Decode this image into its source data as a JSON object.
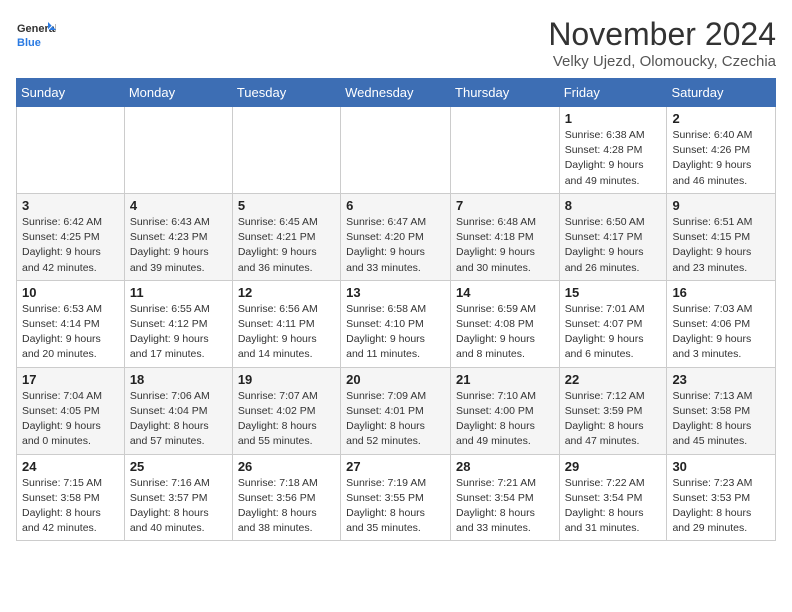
{
  "logo": {
    "line1": "General",
    "line2": "Blue"
  },
  "header": {
    "month": "November 2024",
    "location": "Velky Ujezd, Olomoucky, Czechia"
  },
  "weekdays": [
    "Sunday",
    "Monday",
    "Tuesday",
    "Wednesday",
    "Thursday",
    "Friday",
    "Saturday"
  ],
  "weeks": [
    [
      {
        "day": "",
        "info": ""
      },
      {
        "day": "",
        "info": ""
      },
      {
        "day": "",
        "info": ""
      },
      {
        "day": "",
        "info": ""
      },
      {
        "day": "",
        "info": ""
      },
      {
        "day": "1",
        "info": "Sunrise: 6:38 AM\nSunset: 4:28 PM\nDaylight: 9 hours and 49 minutes."
      },
      {
        "day": "2",
        "info": "Sunrise: 6:40 AM\nSunset: 4:26 PM\nDaylight: 9 hours and 46 minutes."
      }
    ],
    [
      {
        "day": "3",
        "info": "Sunrise: 6:42 AM\nSunset: 4:25 PM\nDaylight: 9 hours and 42 minutes."
      },
      {
        "day": "4",
        "info": "Sunrise: 6:43 AM\nSunset: 4:23 PM\nDaylight: 9 hours and 39 minutes."
      },
      {
        "day": "5",
        "info": "Sunrise: 6:45 AM\nSunset: 4:21 PM\nDaylight: 9 hours and 36 minutes."
      },
      {
        "day": "6",
        "info": "Sunrise: 6:47 AM\nSunset: 4:20 PM\nDaylight: 9 hours and 33 minutes."
      },
      {
        "day": "7",
        "info": "Sunrise: 6:48 AM\nSunset: 4:18 PM\nDaylight: 9 hours and 30 minutes."
      },
      {
        "day": "8",
        "info": "Sunrise: 6:50 AM\nSunset: 4:17 PM\nDaylight: 9 hours and 26 minutes."
      },
      {
        "day": "9",
        "info": "Sunrise: 6:51 AM\nSunset: 4:15 PM\nDaylight: 9 hours and 23 minutes."
      }
    ],
    [
      {
        "day": "10",
        "info": "Sunrise: 6:53 AM\nSunset: 4:14 PM\nDaylight: 9 hours and 20 minutes."
      },
      {
        "day": "11",
        "info": "Sunrise: 6:55 AM\nSunset: 4:12 PM\nDaylight: 9 hours and 17 minutes."
      },
      {
        "day": "12",
        "info": "Sunrise: 6:56 AM\nSunset: 4:11 PM\nDaylight: 9 hours and 14 minutes."
      },
      {
        "day": "13",
        "info": "Sunrise: 6:58 AM\nSunset: 4:10 PM\nDaylight: 9 hours and 11 minutes."
      },
      {
        "day": "14",
        "info": "Sunrise: 6:59 AM\nSunset: 4:08 PM\nDaylight: 9 hours and 8 minutes."
      },
      {
        "day": "15",
        "info": "Sunrise: 7:01 AM\nSunset: 4:07 PM\nDaylight: 9 hours and 6 minutes."
      },
      {
        "day": "16",
        "info": "Sunrise: 7:03 AM\nSunset: 4:06 PM\nDaylight: 9 hours and 3 minutes."
      }
    ],
    [
      {
        "day": "17",
        "info": "Sunrise: 7:04 AM\nSunset: 4:05 PM\nDaylight: 9 hours and 0 minutes."
      },
      {
        "day": "18",
        "info": "Sunrise: 7:06 AM\nSunset: 4:04 PM\nDaylight: 8 hours and 57 minutes."
      },
      {
        "day": "19",
        "info": "Sunrise: 7:07 AM\nSunset: 4:02 PM\nDaylight: 8 hours and 55 minutes."
      },
      {
        "day": "20",
        "info": "Sunrise: 7:09 AM\nSunset: 4:01 PM\nDaylight: 8 hours and 52 minutes."
      },
      {
        "day": "21",
        "info": "Sunrise: 7:10 AM\nSunset: 4:00 PM\nDaylight: 8 hours and 49 minutes."
      },
      {
        "day": "22",
        "info": "Sunrise: 7:12 AM\nSunset: 3:59 PM\nDaylight: 8 hours and 47 minutes."
      },
      {
        "day": "23",
        "info": "Sunrise: 7:13 AM\nSunset: 3:58 PM\nDaylight: 8 hours and 45 minutes."
      }
    ],
    [
      {
        "day": "24",
        "info": "Sunrise: 7:15 AM\nSunset: 3:58 PM\nDaylight: 8 hours and 42 minutes."
      },
      {
        "day": "25",
        "info": "Sunrise: 7:16 AM\nSunset: 3:57 PM\nDaylight: 8 hours and 40 minutes."
      },
      {
        "day": "26",
        "info": "Sunrise: 7:18 AM\nSunset: 3:56 PM\nDaylight: 8 hours and 38 minutes."
      },
      {
        "day": "27",
        "info": "Sunrise: 7:19 AM\nSunset: 3:55 PM\nDaylight: 8 hours and 35 minutes."
      },
      {
        "day": "28",
        "info": "Sunrise: 7:21 AM\nSunset: 3:54 PM\nDaylight: 8 hours and 33 minutes."
      },
      {
        "day": "29",
        "info": "Sunrise: 7:22 AM\nSunset: 3:54 PM\nDaylight: 8 hours and 31 minutes."
      },
      {
        "day": "30",
        "info": "Sunrise: 7:23 AM\nSunset: 3:53 PM\nDaylight: 8 hours and 29 minutes."
      }
    ]
  ]
}
